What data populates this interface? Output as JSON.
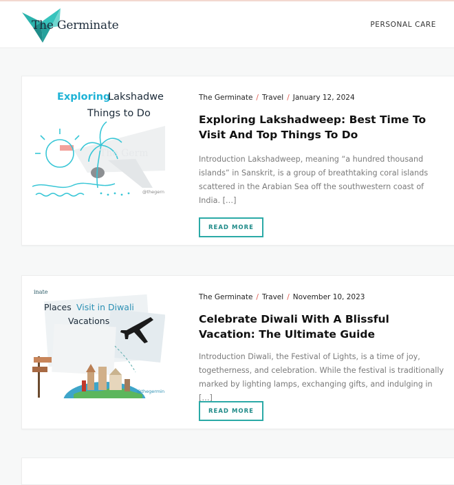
{
  "site": {
    "logo_text": "The Germinate",
    "nav": [
      "PERSONAL CARE"
    ]
  },
  "posts": [
    {
      "author": "The Germinate",
      "category": "Travel",
      "date": "January 12, 2024",
      "title": "Exploring Lakshadweep: Best Time To Visit And Top Things To Do",
      "excerpt": "Introduction Lakshadweep, meaning “a hundred thousand islands” in Sanskrit, is a group of breathtaking coral islands scattered in the Arabian Sea off the southwestern coast of India. […]",
      "read_more": "READ MORE",
      "thumb": {
        "title_a": "Exploring",
        "title_b": "Lakshadwe",
        "title_c": "Things to Do",
        "watermark": "The Germ",
        "handle": "@thegern"
      }
    },
    {
      "author": "The Germinate",
      "category": "Travel",
      "date": "November 10, 2023",
      "title": "Celebrate Diwali With A Blissful Vacation: The Ultimate Guide",
      "excerpt": "Introduction Diwali, the Festival of Lights, is a time of joy, togetherness, and celebration. While the festival is traditionally marked by lighting lamps, exchanging gifts, and indulging in […]",
      "read_more": "READ MORE",
      "thumb": {
        "brand": "inate",
        "title_a": "Places",
        "title_b": "Visit in Diwali",
        "title_c": "Vacations",
        "handle": "@thegermin"
      }
    }
  ],
  "colors": {
    "accent": "#2aa9a6",
    "separator": "#e05a4e",
    "excerpt": "#7a7a7a"
  },
  "icons": [
    "origami-bird-logo-icon",
    "palm-tree-icon",
    "sun-icon",
    "airplane-icon",
    "signpost-icon",
    "globe-icon"
  ]
}
